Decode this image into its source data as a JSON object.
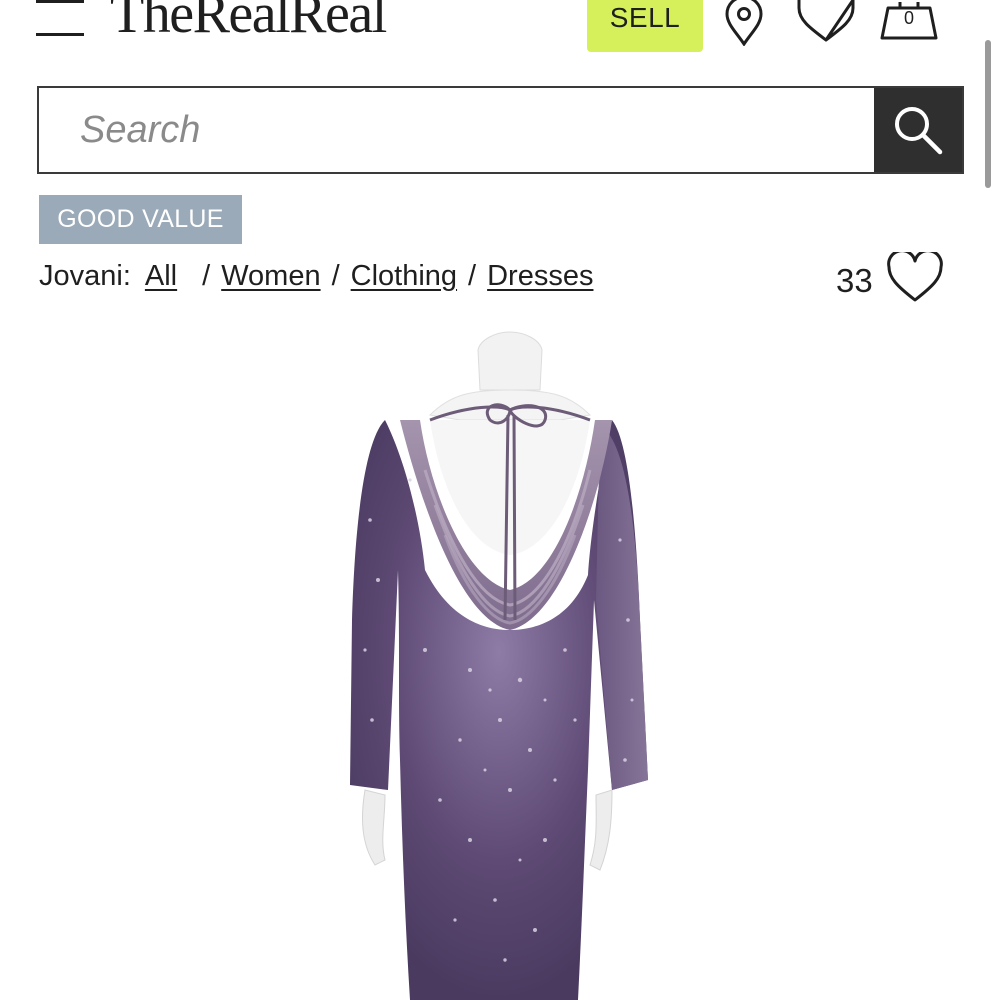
{
  "header": {
    "menu_icon": "hamburger-menu-icon",
    "logo_text": "TheRealReal",
    "sell_label": "SELL",
    "sell_color": "#d6f05b",
    "bag_count": "0"
  },
  "search": {
    "placeholder": "Search",
    "button_icon": "search-icon",
    "button_color": "#2f2f2f"
  },
  "product": {
    "badge": "GOOD VALUE",
    "badge_color": "#9aaab8",
    "breadcrumb": {
      "brand": "Jovani:",
      "items": [
        "All",
        "Women",
        "Clothing",
        "Dresses"
      ]
    },
    "favorites_count": "33",
    "dress_color": "#5c4a6e"
  }
}
